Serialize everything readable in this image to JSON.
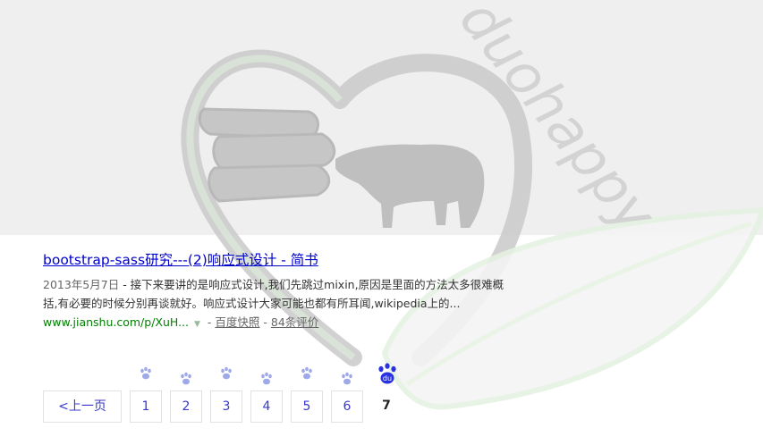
{
  "watermark": {
    "text": "duohappy"
  },
  "result": {
    "title": "bootstrap-sass研究---(2)响应式设计 - 简书",
    "date": "2013年5月7日",
    "snippet": " - 接下来要讲的是响应式设计,我们先跳过mixin,原因是里面的方法太多很难概括,有必要的时候分别再谈就好。响应式设计大家可能也都有所耳闻,wikipedia上的...",
    "url": "www.jianshu.com/p/XuH...",
    "sep1": " - ",
    "cache_label": "百度快照",
    "sep2": " - ",
    "reviews_label": "84条评价"
  },
  "pager": {
    "prev_label": "<上一页",
    "pages": [
      "1",
      "2",
      "3",
      "4",
      "5",
      "6"
    ],
    "current": "7",
    "current_logo": "du"
  },
  "colors": {
    "link": "#0000cc",
    "url_green": "#008000",
    "pager_text": "#3838cc",
    "paw": "#9fa8e8",
    "paw_current": "#2932e1"
  }
}
